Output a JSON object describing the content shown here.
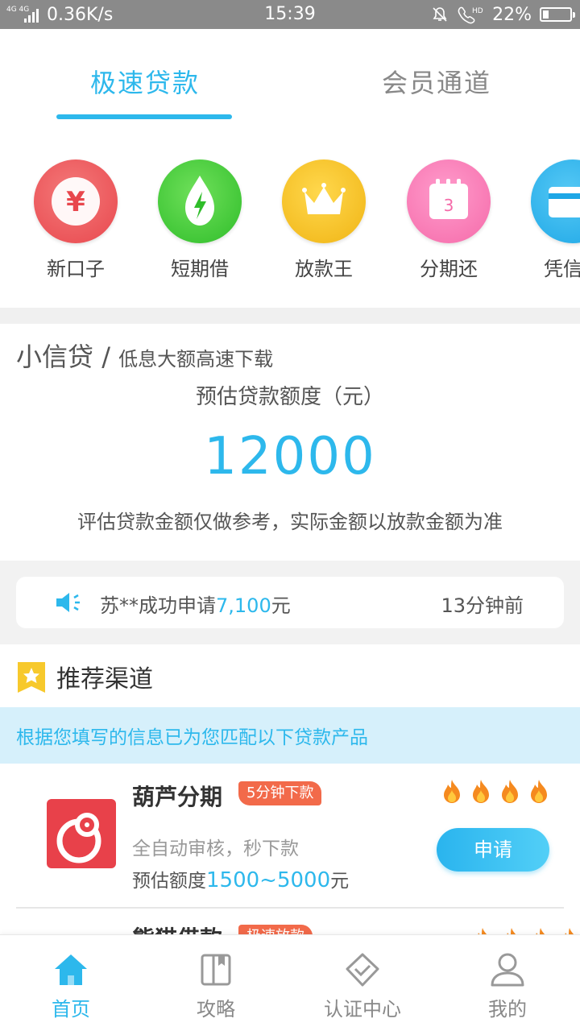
{
  "status_bar": {
    "network_label": "4G 4G",
    "speed": "0.36K/s",
    "time": "15:39",
    "battery": "22%",
    "battery_level": 0.22,
    "hd_label": "HD",
    "icons": [
      "signal-icon",
      "mute-icon",
      "call-hd-icon",
      "battery-icon"
    ]
  },
  "tabs": [
    {
      "label": "极速贷款",
      "active": true
    },
    {
      "label": "会员通道",
      "active": false
    }
  ],
  "categories": [
    {
      "label": "新口子",
      "icon": "yen-icon",
      "glyph": "¥",
      "color": "#e8474d"
    },
    {
      "label": "短期借",
      "icon": "lightning-drop-icon",
      "color": "#2fbd2a"
    },
    {
      "label": "放款王",
      "icon": "crown-icon",
      "color": "#f0b414"
    },
    {
      "label": "分期还",
      "icon": "calendar-icon",
      "glyph": "3",
      "color": "#f56aa9"
    },
    {
      "label": "凭信用",
      "icon": "card-icon",
      "color": "#1ea7e6"
    }
  ],
  "loan": {
    "title": "小信贷",
    "separator": "/",
    "subtitle": "低息大额高速下载",
    "amount_label": "预估贷款额度（元）",
    "amount": "12000",
    "note": "评估贷款金额仅做参考，实际金额以放款金额为准"
  },
  "notice": {
    "prefix": "苏**成功申请",
    "amount": "7,100",
    "suffix": "元",
    "time": "13分钟前"
  },
  "recommend": {
    "title": "推荐渠道",
    "hint": "根据您填写的信息已为您匹配以下贷款产品"
  },
  "products": [
    {
      "name": "葫芦分期",
      "tag": "5分钟下款",
      "desc": "全自动审核，秒下款",
      "quota_label": "预估额度",
      "quota": "1500~5000",
      "quota_unit": "元",
      "apply": "申请",
      "rating": 4
    },
    {
      "name": "熊猫借款",
      "tag": "极速放款",
      "rating": 4
    }
  ],
  "bottom_nav": [
    {
      "label": "首页",
      "icon": "home-icon",
      "active": true
    },
    {
      "label": "攻略",
      "icon": "book-icon",
      "active": false
    },
    {
      "label": "认证中心",
      "icon": "shield-check-icon",
      "active": false
    },
    {
      "label": "我的",
      "icon": "user-icon",
      "active": false
    }
  ],
  "colors": {
    "accent": "#2db8ec",
    "tag": "#f26a4a",
    "status_bar": "#8a8a8a"
  }
}
